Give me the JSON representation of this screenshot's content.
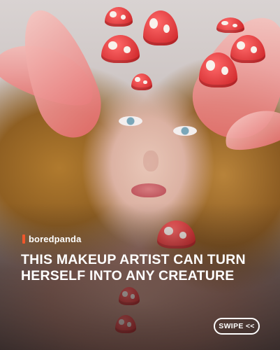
{
  "brand": {
    "name": "boredpanda",
    "accent_color": "#f0572c"
  },
  "headline": {
    "line1": "THIS MAKEUP ARTIST CAN TURN",
    "line2": "HERSELF INTO ANY CREATURE"
  },
  "swipe_button": {
    "label": "SWIPE <<"
  }
}
